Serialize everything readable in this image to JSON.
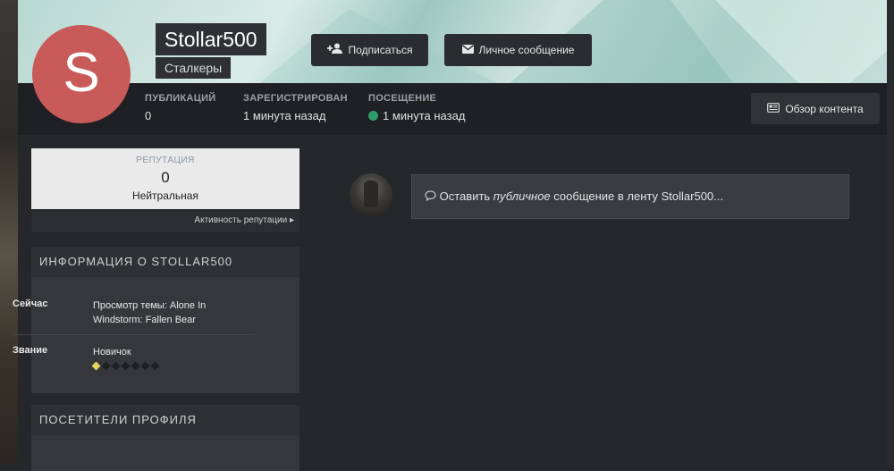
{
  "profile": {
    "avatar_letter": "S",
    "username": "Stollar500",
    "group": "Сталкеры",
    "follow_label": "Подписаться",
    "message_label": "Личное сообщение",
    "content_label": "Обзор контента"
  },
  "stats": [
    {
      "label": "ПУБЛИКАЦИЙ",
      "value": "0"
    },
    {
      "label": "ЗАРЕГИСТРИРОВАН",
      "value": "1 минута назад"
    },
    {
      "label": "ПОСЕЩЕНИЕ",
      "value": "1 минута назад",
      "online": true
    }
  ],
  "reputation": {
    "title": "РЕПУТАЦИЯ",
    "value": "0",
    "text": "Нейтральная",
    "activity_link": "Активность репутации"
  },
  "about": {
    "title": "ИНФОРМАЦИЯ О STOLLAR500",
    "now_label": "Сейчас",
    "now_value": "Просмотр темы: Alone In Windstorm: Fallen Bear",
    "rank_label": "Звание",
    "rank_value": "Новичок",
    "rank_pips_total": 7,
    "rank_pips_filled": 1
  },
  "visitors": {
    "title": "ПОСЕТИТЕЛИ ПРОФИЛЯ"
  },
  "feed": {
    "prefix": "Оставить ",
    "italic": "публичное",
    "suffix": " сообщение в ленту Stollar500..."
  },
  "colors": {
    "avatar_bg": "#c95a5a",
    "online_dot": "#2e9c6a",
    "rank_pip_on": "#e6d45c"
  }
}
